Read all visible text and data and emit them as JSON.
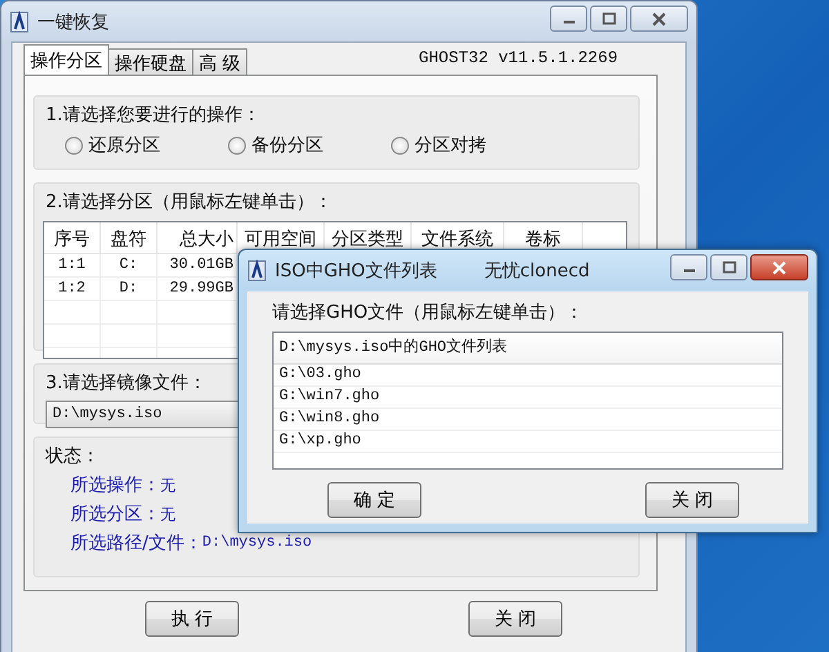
{
  "main_window": {
    "title": "一键恢复",
    "tabs": [
      {
        "label": "操作分区",
        "selected": true
      },
      {
        "label": "操作硬盘",
        "selected": false
      },
      {
        "label": "高 级",
        "selected": false
      }
    ],
    "version": "GHOST32 v11.5.1.2269",
    "operation_group": {
      "label": "1.请选择您要进行的操作：",
      "options": [
        {
          "label": "还原分区",
          "selected": false
        },
        {
          "label": "备份分区",
          "selected": false
        },
        {
          "label": "分区对拷",
          "selected": false
        }
      ]
    },
    "partition_group": {
      "label": "2.请选择分区（用鼠标左键单击）：",
      "columns": [
        "序号",
        "盘符",
        "总大小",
        "可用空间",
        "分区类型",
        "文件系统",
        "卷标"
      ],
      "rows": [
        [
          "1:1",
          "C:",
          "30.01GB"
        ],
        [
          "1:2",
          "D:",
          "29.99GB"
        ]
      ]
    },
    "image_group": {
      "label": "3.请选择镜像文件：",
      "value": "D:\\mysys.iso"
    },
    "status": {
      "label": "状态：",
      "lines": [
        {
          "label": "所选操作：",
          "value": "无"
        },
        {
          "label": "所选分区：",
          "value": "无"
        },
        {
          "label": "所选路径/文件：",
          "value": "D:\\mysys.iso"
        }
      ]
    },
    "buttons": [
      "执 行",
      "关 闭"
    ]
  },
  "dialog": {
    "title": "ISO中GHO文件列表",
    "subtitle": "无忧clonecd",
    "prompt": "请选择GHO文件（用鼠标左键单击）：",
    "list_header": "D:\\mysys.iso中的GHO文件列表",
    "files": [
      "G:\\03.gho",
      "G:\\win7.gho",
      "G:\\win8.gho",
      "G:\\xp.gho"
    ],
    "buttons": [
      "确 定",
      "关 闭"
    ]
  }
}
